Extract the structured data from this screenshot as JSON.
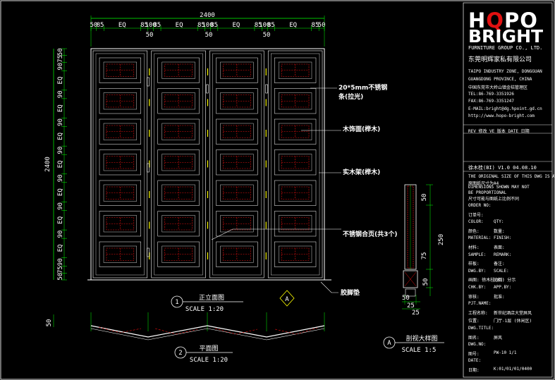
{
  "brand": {
    "logo_top": "HQPO",
    "logo_bottom": "BRIGHT",
    "company_en": "FURNITURE GROUP CO., LTD.",
    "company_cn": "东莞明辉家私有限公司",
    "accent_color": "#e11111"
  },
  "title_block": {
    "address_lines": [
      "TAIPO INDUSTRY ZONE, DONGGUAN",
      "GUANGDONG PROVINCE, CHINA",
      "中国东莞市大岭山镇金桔管理区",
      "TEL:86-769-3351926",
      "FAX:86-769-3351247",
      "E-MAIL:bright@dg.hpoint.gd.cn",
      "http://www.hopo-bright.com"
    ],
    "rev_header": "REV 修改   VE 版本   DATE 日期",
    "revision": "徐木桂(BI) V1.0    04.08.10",
    "notes": [
      "THE ORIGINAL SIZE OF THIS DWG IS A4",
      "原图纸尺寸为A4",
      "DIMENSIONS SHOWN MAY NOT",
      "BE PROPORTIONAL",
      "尺寸可能与图纸上比例不同"
    ],
    "fields": [
      {
        "label": "ORDER NO:",
        "value": ""
      },
      {
        "label": "订单号:",
        "value": ""
      },
      {
        "label": "COLOR:",
        "value": "QTY:"
      },
      {
        "label": "颜色:",
        "value": "数量:"
      },
      {
        "label": "MATERIAL:",
        "value": "FINISH:"
      },
      {
        "label": "材料:",
        "value": "表面:"
      },
      {
        "label": "SAMPLE:",
        "value": "REMARK:"
      },
      {
        "label": "样板:",
        "value": "备注:"
      },
      {
        "label": "DWG.BY:",
        "value": "SCALE:"
      },
      {
        "label": "画图: 徐木桂(BI)",
        "value": "比例:  分示"
      },
      {
        "label": "CHK.BY:",
        "value": "APP.BY:"
      },
      {
        "label": "审核:",
        "value": "批准:"
      },
      {
        "label": "PJT.NAME:",
        "value": ""
      },
      {
        "label": "工程名称:",
        "value": "新世纪酒店大堂屏风"
      },
      {
        "label": "位置:",
        "value": "门厅-1层 (休闲区)"
      },
      {
        "label": "DWG.TITLE:",
        "value": ""
      },
      {
        "label": "图名:",
        "value": "屏风"
      },
      {
        "label": "DWG.NO:",
        "value": ""
      },
      {
        "label": "图号:",
        "value": "PW-10       1/1"
      },
      {
        "label": "DATE:",
        "value": ""
      },
      {
        "label": "日期:",
        "value": "K:01/01/01/0400"
      }
    ]
  },
  "elevation": {
    "overall_width": "2400",
    "overall_height": "2400",
    "top_dims": [
      "50",
      "85",
      "EQ",
      "85",
      "100",
      "85",
      "EQ",
      "85",
      "100",
      "85",
      "EQ",
      "85",
      "100",
      "85",
      "EQ",
      "85",
      "50"
    ],
    "top_dims_sub": [
      "50",
      "50",
      "50"
    ],
    "left_dims": [
      "50",
      "75",
      "90",
      "EQ",
      "90",
      "EQ",
      "90",
      "EQ",
      "90",
      "EQ",
      "90",
      "EQ",
      "90",
      "EQ",
      "90",
      "EQ",
      "90",
      "75",
      "50"
    ],
    "caption_num": "1",
    "caption_title": "正立面图",
    "caption_scale": "SCALE 1:20"
  },
  "plan": {
    "dim_left": "50",
    "caption_num": "2",
    "caption_title": "平面图",
    "caption_scale": "SCALE 1:20"
  },
  "detail": {
    "dims_right": [
      "50",
      "250",
      "75",
      "50"
    ],
    "dims_bottom": [
      "50",
      "25",
      "25"
    ],
    "marker": "A",
    "caption_num": "A",
    "caption_title": "剖视大样图",
    "caption_scale": "SCALE 1:5"
  },
  "annotations": {
    "stainless_strip": "20*5mm不锈钢",
    "stainless_strip2": "条(拉光)",
    "wood_face": "木饰面(榉木)",
    "solid_frame": "实木架(榉木)",
    "hinge": "不锈钢合页(共3个)",
    "rubber_pad": "胶脚垫"
  }
}
